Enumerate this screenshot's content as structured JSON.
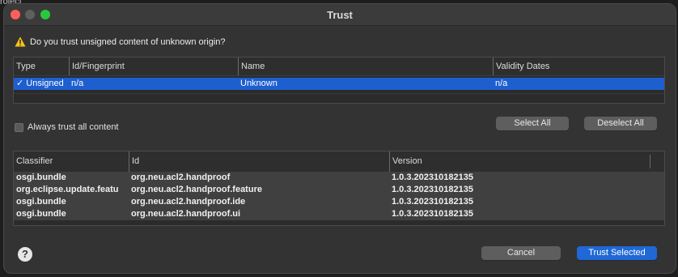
{
  "background_hint": "roject",
  "window": {
    "title": "Trust"
  },
  "question": "Do you trust unsigned content of unknown origin?",
  "certificates_table": {
    "columns": [
      "Type",
      "Id/Fingerprint",
      "Name",
      "Validity Dates"
    ],
    "rows": [
      {
        "checked": true,
        "type": "Unsigned",
        "id": "n/a",
        "name": "Unknown",
        "validity": "n/a"
      }
    ]
  },
  "always_trust": {
    "label": "Always trust all content",
    "checked": false
  },
  "buttons": {
    "select_all": "Select All",
    "deselect_all": "Deselect All",
    "cancel": "Cancel",
    "trust_selected": "Trust Selected"
  },
  "artifacts_table": {
    "columns": [
      "Classifier",
      "Id",
      "Version"
    ],
    "rows": [
      {
        "classifier": "osgi.bundle",
        "id": "org.neu.acl2.handproof",
        "version": "1.0.3.202310182135"
      },
      {
        "classifier": "org.eclipse.update.featu",
        "id": "org.neu.acl2.handproof.feature",
        "version": "1.0.3.202310182135"
      },
      {
        "classifier": "osgi.bundle",
        "id": "org.neu.acl2.handproof.ide",
        "version": "1.0.3.202310182135"
      },
      {
        "classifier": "osgi.bundle",
        "id": "org.neu.acl2.handproof.ui",
        "version": "1.0.3.202310182135"
      }
    ]
  },
  "help": {
    "icon": "help-icon",
    "glyph": "?"
  },
  "colors": {
    "selection": "#1e5fd0",
    "primary_button": "#1f68d6",
    "warning": "#f5c518"
  }
}
